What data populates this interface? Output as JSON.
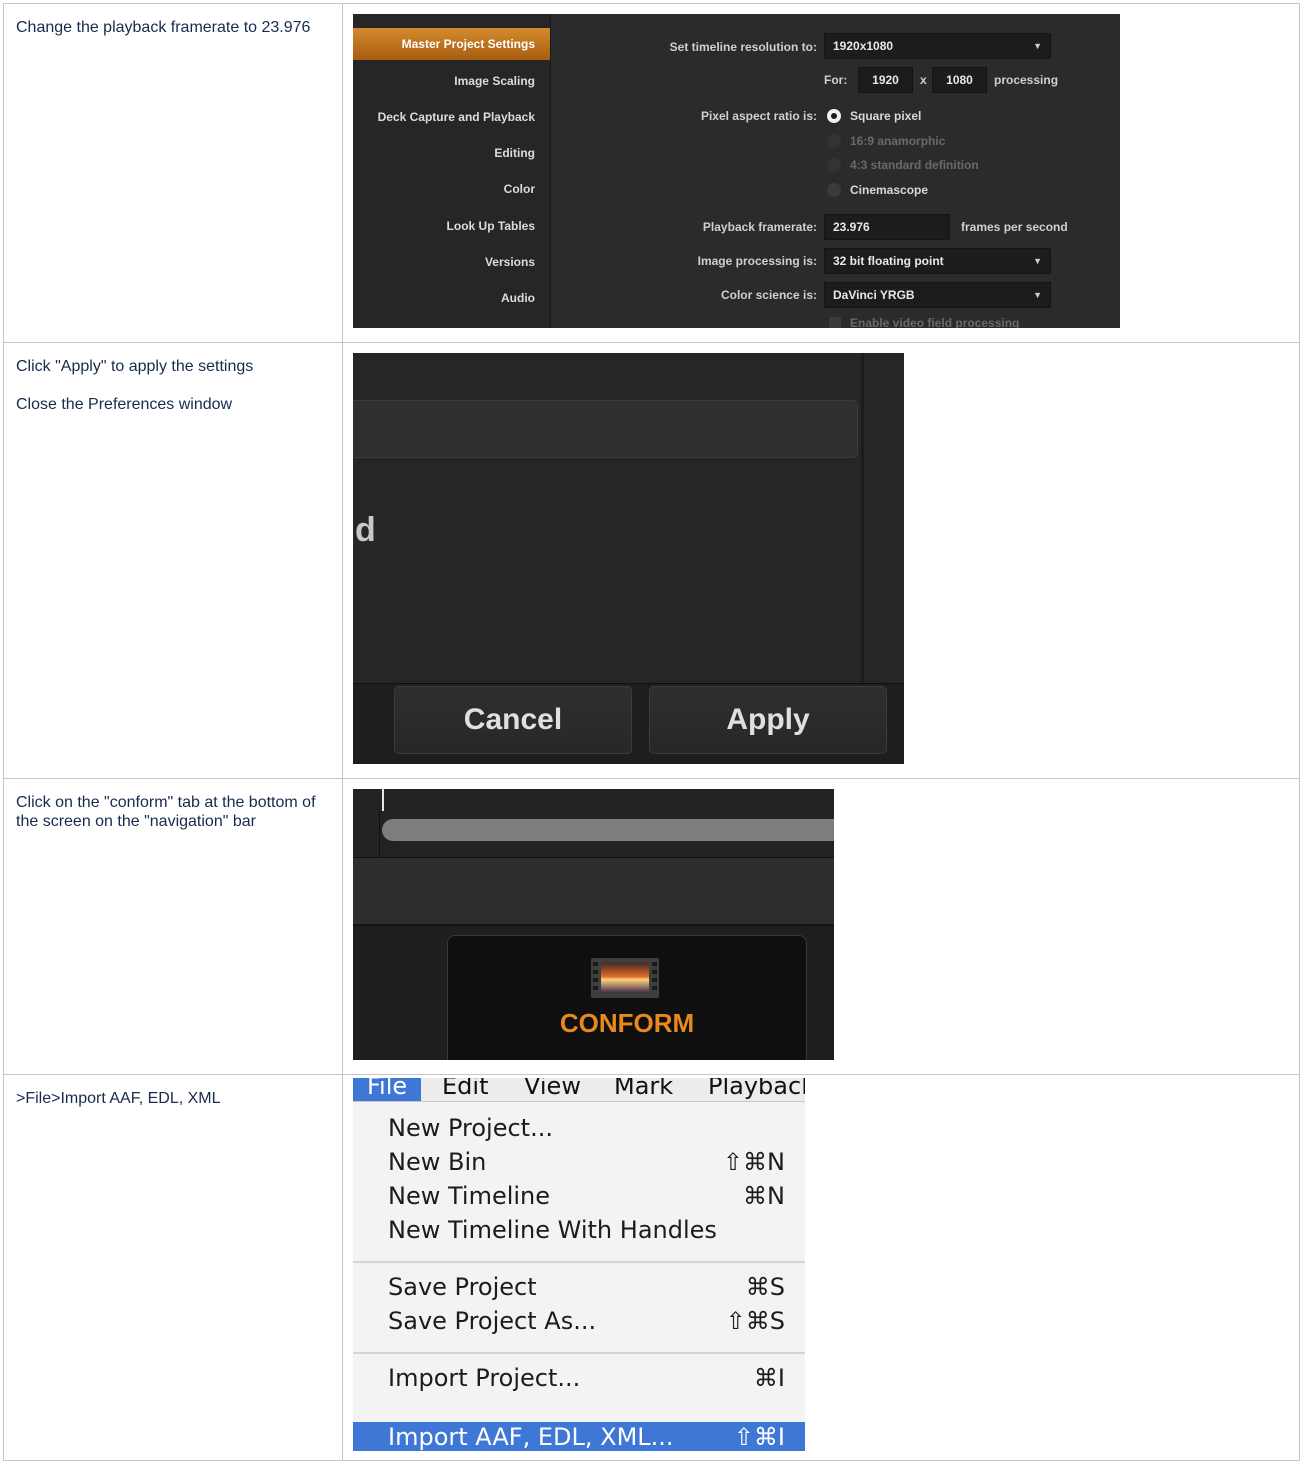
{
  "rows": [
    {
      "instruction": [
        "Change the playback framerate to 23.976"
      ]
    },
    {
      "instruction": [
        "Click \"Apply\" to apply the settings",
        "Close the Preferences window"
      ]
    },
    {
      "instruction": [
        "Click on the \"conform\" tab at the bottom of the screen on the \"navigation\" bar"
      ]
    },
    {
      "instruction": [
        ">File>Import AAF, EDL, XML"
      ]
    }
  ],
  "settings": {
    "sidebar": [
      "Master Project Settings",
      "Image Scaling",
      "Deck Capture and Playback",
      "Editing",
      "Color",
      "Look Up Tables",
      "Versions",
      "Audio"
    ],
    "timeline_resolution_label": "Set timeline resolution to:",
    "timeline_resolution_value": "1920x1080",
    "for_label": "For:",
    "width": "1920",
    "times": "x",
    "height": "1080",
    "processing": "processing",
    "pixel_aspect_label": "Pixel aspect ratio is:",
    "pixel_aspect_options": [
      "Square pixel",
      "16:9 anamorphic",
      "4:3 standard definition",
      "Cinemascope"
    ],
    "playback_label": "Playback framerate:",
    "playback_value": "23.976",
    "fps_label": "frames per second",
    "image_processing_label": "Image processing is:",
    "image_processing_value": "32 bit floating point",
    "color_science_label": "Color science is:",
    "color_science_value": "DaVinci YRGB",
    "field_processing": "Enable video field processing",
    "accent_color": "#d38a2d"
  },
  "dialog": {
    "partial_text": "d",
    "cancel": "Cancel",
    "apply": "Apply"
  },
  "conform": {
    "tab_label": "CONFORM",
    "accent_color": "#e68a1e"
  },
  "menu": {
    "menubar": [
      "File",
      "Edit",
      "View",
      "Mark",
      "Playbacl"
    ],
    "items": [
      {
        "label": "New Project...",
        "shortcut": ""
      },
      {
        "label": "New Bin",
        "shortcut": "⇧⌘N"
      },
      {
        "label": "New Timeline",
        "shortcut": "⌘N"
      },
      {
        "label": "New Timeline With Handles",
        "shortcut": ""
      },
      {
        "label": "Save Project",
        "shortcut": "⌘S"
      },
      {
        "label": "Save Project As...",
        "shortcut": "⇧⌘S"
      },
      {
        "label": "Import Project...",
        "shortcut": "⌘I"
      },
      {
        "label": "Import AAF, EDL, XML...",
        "shortcut": "⇧⌘I"
      }
    ],
    "highlight_color": "#3f77d6"
  }
}
